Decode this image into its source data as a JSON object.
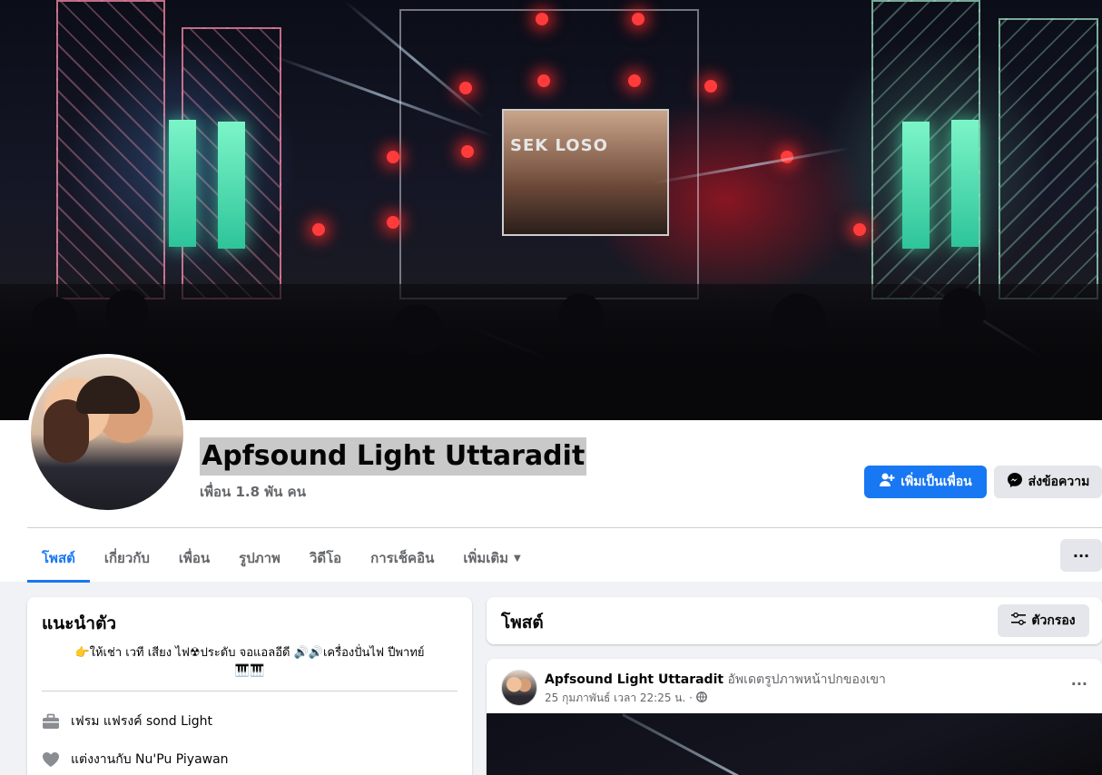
{
  "profile": {
    "name": "Apfsound Light Uttaradit",
    "friends_count": "เพื่อน 1.8 พัน คน"
  },
  "cover": {
    "screen_text": "SEK LOSO"
  },
  "actions": {
    "add_friend": "เพิ่มเป็นเพื่อน",
    "message": "ส่งข้อความ",
    "more": "···"
  },
  "tabs": [
    {
      "label": "โพสต์",
      "active": true
    },
    {
      "label": "เกี่ยวกับ"
    },
    {
      "label": "เพื่อน"
    },
    {
      "label": "รูปภาพ"
    },
    {
      "label": "วิดีโอ"
    },
    {
      "label": "การเช็คอิน"
    },
    {
      "label": "เพิ่มเติม"
    }
  ],
  "intro": {
    "title": "แนะนำตัว",
    "bio_line1": "👉ให้เช่า เวที เสียง ไฟ☢ประดับ จอแอลอีดี 🔊🔊เครื่องปั่นไฟ ปีพาทย์",
    "bio_line2": "🎹🎹",
    "work_text": "เฟรม แฟรงค์ sond Light",
    "relationship_prefix": "แต่งงานกับ ",
    "relationship_name": "Nu'Pu Piyawan"
  },
  "posts": {
    "title": "โพสต์",
    "filter_label": "ตัวกรอง"
  },
  "post": {
    "author": "Apfsound Light Uttaradit",
    "action": " อัพเดตรูปภาพหน้าปกของเขา",
    "timestamp": "25 กุมภาพันธ์ เวลา 22:25 น. ·",
    "more": "···"
  },
  "colors": {
    "accent": "#1877f2",
    "background": "#f0f2f5",
    "secondary_text": "#65676b"
  }
}
